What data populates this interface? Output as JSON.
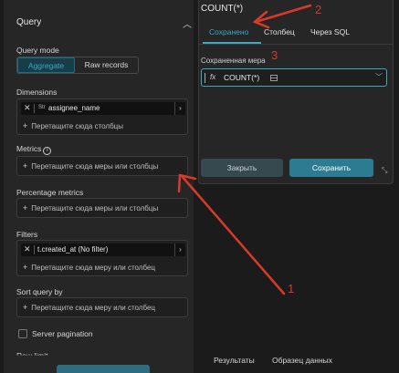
{
  "query_panel": {
    "title": "Query",
    "query_mode_label": "Query mode",
    "modes": [
      "Aggregate",
      "Raw records"
    ],
    "dimensions": {
      "label": "Dimensions",
      "chip_text": "assignee_name",
      "chip_type": "Str",
      "drop_hint": "Перетащите сюда столбцы"
    },
    "metrics": {
      "label": "Metrics",
      "drop_hint": "Перетащите сюда меры или столбцы"
    },
    "percentage_metrics": {
      "label": "Percentage metrics",
      "drop_hint": "Перетащите сюда меры или столбцы"
    },
    "filters": {
      "label": "Filters",
      "chip_text": "t.created_at (No filter)",
      "drop_hint": "Перетащите сюда меру или столбец"
    },
    "sort": {
      "label": "Sort query by",
      "drop_hint": "Перетащите сюда меру или столбец"
    },
    "server_pagination_label": "Server pagination",
    "row_limit_label": "Row limit"
  },
  "metric_popover": {
    "title": "COUNT(*)",
    "tabs": [
      "Сохранено",
      "Столбец",
      "Через SQL"
    ],
    "saved_measure_label": "Сохраненная мера",
    "saved_measure_value": "COUNT(*)",
    "fx_label": "fx",
    "close_label": "Закрыть",
    "save_label": "Сохранить"
  },
  "results_tabs": [
    "Результаты",
    "Образец данных"
  ],
  "annotations": [
    "1",
    "2",
    "3"
  ],
  "colors": {
    "accent": "#3ea7c2",
    "arrow": "#d83a2a",
    "save_button": "#2c7b90"
  }
}
